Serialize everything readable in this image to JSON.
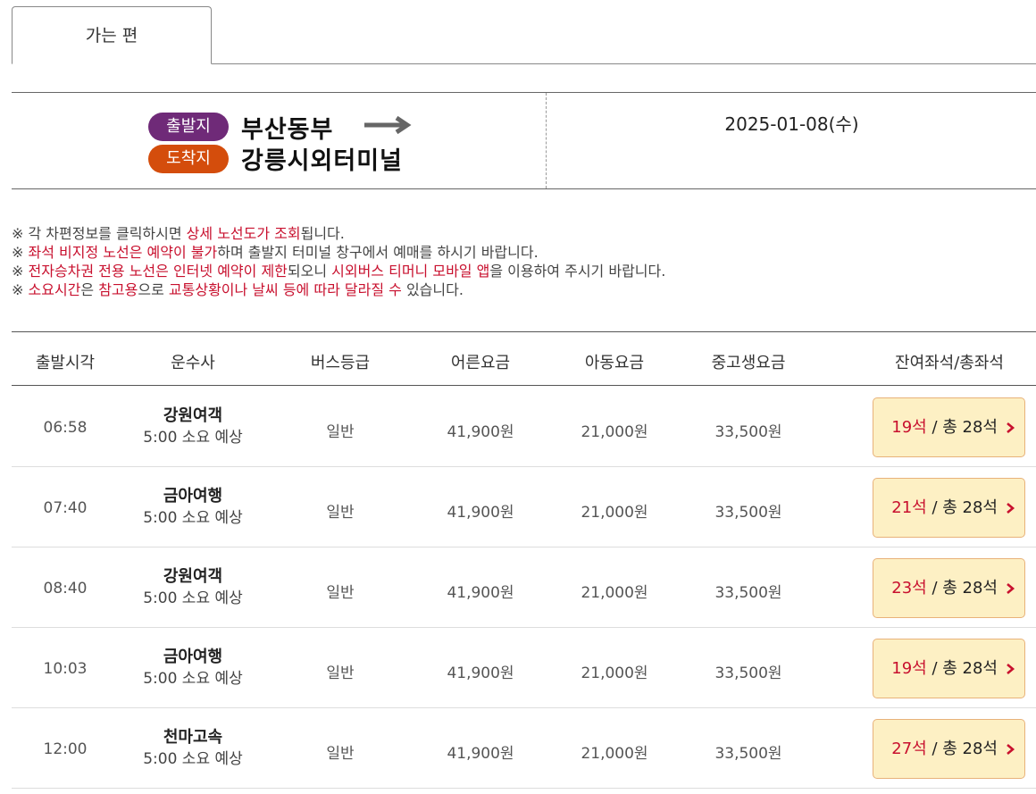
{
  "tab": {
    "label": "가는 편"
  },
  "route": {
    "departure_badge": "출발지",
    "arrival_badge": "도착지",
    "departure": "부산동부",
    "arrival": "강릉시외터미널",
    "date": "2025-01-08(수)"
  },
  "notices": [
    {
      "mark": "※",
      "parts": [
        {
          "t": " 각 차편정보를 클릭하시면 ",
          "red": false
        },
        {
          "t": "상세 노선도가 조회",
          "red": true
        },
        {
          "t": "됩니다.",
          "red": false
        }
      ]
    },
    {
      "mark": "※",
      "parts": [
        {
          "t": " ",
          "red": false
        },
        {
          "t": "좌석 비지정 노선은 예약이 불가",
          "red": true
        },
        {
          "t": "하며 출발지 터미널 창구에서 예매를 하시기 바랍니다.",
          "red": false
        }
      ]
    },
    {
      "mark": "※",
      "parts": [
        {
          "t": " ",
          "red": false
        },
        {
          "t": "전자승차권 전용 노선은 인터넷 예약이 제한",
          "red": true
        },
        {
          "t": "되오니 ",
          "red": false
        },
        {
          "t": "시외버스 티머니 모바일 앱",
          "red": true
        },
        {
          "t": "을 이용하여 주시기 바랍니다.",
          "red": false
        }
      ]
    },
    {
      "mark": "※",
      "parts": [
        {
          "t": " ",
          "red": false
        },
        {
          "t": "소요시간",
          "red": true
        },
        {
          "t": "은 ",
          "red": false
        },
        {
          "t": "참고용",
          "red": true
        },
        {
          "t": "으로 ",
          "red": false
        },
        {
          "t": "교통상황이나 날씨 등에 따라 달라질 수",
          "red": true
        },
        {
          "t": " 있습니다.",
          "red": false
        }
      ]
    }
  ],
  "table": {
    "headers": {
      "time": "출발시각",
      "company": "운수사",
      "grade": "버스등급",
      "adult": "어른요금",
      "child": "아동요금",
      "student": "중고생요금",
      "seats": "잔여좌석/총좌석"
    },
    "rows": [
      {
        "time": "06:58",
        "company": "강원여객",
        "duration": "5:00 소요 예상",
        "grade": "일반",
        "adult": "41,900원",
        "child": "21,000원",
        "student": "33,500원",
        "remaining": "19석",
        "total": " / 총 28석"
      },
      {
        "time": "07:40",
        "company": "금아여행",
        "duration": "5:00 소요 예상",
        "grade": "일반",
        "adult": "41,900원",
        "child": "21,000원",
        "student": "33,500원",
        "remaining": "21석",
        "total": " / 총 28석"
      },
      {
        "time": "08:40",
        "company": "강원여객",
        "duration": "5:00 소요 예상",
        "grade": "일반",
        "adult": "41,900원",
        "child": "21,000원",
        "student": "33,500원",
        "remaining": "23석",
        "total": " / 총 28석"
      },
      {
        "time": "10:03",
        "company": "금아여행",
        "duration": "5:00 소요 예상",
        "grade": "일반",
        "adult": "41,900원",
        "child": "21,000원",
        "student": "33,500원",
        "remaining": "19석",
        "total": " / 총 28석"
      },
      {
        "time": "12:00",
        "company": "천마고속",
        "duration": "5:00 소요 예상",
        "grade": "일반",
        "adult": "41,900원",
        "child": "21,000원",
        "student": "33,500원",
        "remaining": "27석",
        "total": " / 총 28석"
      }
    ]
  },
  "colors": {
    "departure_badge": "#6f2a78",
    "arrival_badge": "#d44d0c",
    "highlight_red": "#c8102e",
    "seat_button_bg": "#fdf0c4",
    "seat_button_border": "#e8b27a"
  }
}
